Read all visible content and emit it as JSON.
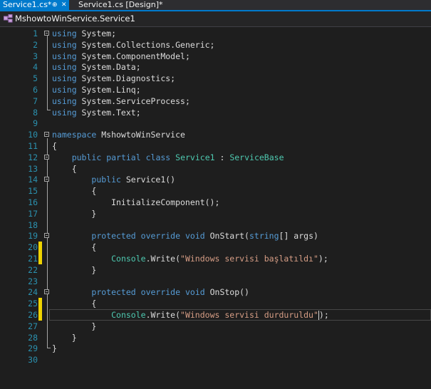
{
  "tabs": [
    {
      "label": "Service1.cs*",
      "pin_icon": "pin-icon",
      "close_icon": "close-icon",
      "active": true
    },
    {
      "label": "Service1.cs [Design]*",
      "active": false
    }
  ],
  "navbar": {
    "icon": "class-icon",
    "label": "MshowtoWinService.Service1"
  },
  "colors": {
    "keyword": "#569cd6",
    "type": "#4ec9b0",
    "string": "#d69d85",
    "line_number": "#2b91af",
    "active_tab": "#007acc",
    "change_marker": "#efd300"
  },
  "editor": {
    "lines": [
      {
        "num": "1",
        "tokens": [
          [
            "kw",
            "using"
          ],
          [
            "p",
            " System;"
          ]
        ],
        "fold": true
      },
      {
        "num": "2",
        "tokens": [
          [
            "kw",
            "using"
          ],
          [
            "p",
            " System.Collections.Generic;"
          ]
        ]
      },
      {
        "num": "3",
        "tokens": [
          [
            "kw",
            "using"
          ],
          [
            "p",
            " System.ComponentModel;"
          ]
        ]
      },
      {
        "num": "4",
        "tokens": [
          [
            "kw",
            "using"
          ],
          [
            "p",
            " System.Data;"
          ]
        ]
      },
      {
        "num": "5",
        "tokens": [
          [
            "kw",
            "using"
          ],
          [
            "p",
            " System.Diagnostics;"
          ]
        ]
      },
      {
        "num": "6",
        "tokens": [
          [
            "kw",
            "using"
          ],
          [
            "p",
            " System.Linq;"
          ]
        ]
      },
      {
        "num": "7",
        "tokens": [
          [
            "kw",
            "using"
          ],
          [
            "p",
            " System.ServiceProcess;"
          ]
        ]
      },
      {
        "num": "8",
        "tokens": [
          [
            "kw",
            "using"
          ],
          [
            "p",
            " System.Text;"
          ]
        ]
      },
      {
        "num": "9",
        "tokens": []
      },
      {
        "num": "10",
        "tokens": [
          [
            "kw",
            "namespace"
          ],
          [
            "p",
            " MshowtoWinService"
          ]
        ],
        "fold": true
      },
      {
        "num": "11",
        "tokens": [
          [
            "p",
            "{"
          ]
        ]
      },
      {
        "num": "12",
        "tokens": [
          [
            "p",
            "    "
          ],
          [
            "kw",
            "public"
          ],
          [
            "p",
            " "
          ],
          [
            "kw",
            "partial"
          ],
          [
            "p",
            " "
          ],
          [
            "kw",
            "class"
          ],
          [
            "p",
            " "
          ],
          [
            "ty",
            "Service1"
          ],
          [
            "p",
            " : "
          ],
          [
            "ty",
            "ServiceBase"
          ]
        ],
        "fold": true
      },
      {
        "num": "13",
        "tokens": [
          [
            "p",
            "    {"
          ]
        ]
      },
      {
        "num": "14",
        "tokens": [
          [
            "p",
            "        "
          ],
          [
            "kw",
            "public"
          ],
          [
            "p",
            " Service1()"
          ]
        ],
        "fold": true
      },
      {
        "num": "15",
        "tokens": [
          [
            "p",
            "        {"
          ]
        ]
      },
      {
        "num": "16",
        "tokens": [
          [
            "p",
            "            InitializeComponent();"
          ]
        ]
      },
      {
        "num": "17",
        "tokens": [
          [
            "p",
            "        }"
          ]
        ]
      },
      {
        "num": "18",
        "tokens": []
      },
      {
        "num": "19",
        "tokens": [
          [
            "p",
            "        "
          ],
          [
            "kw",
            "protected"
          ],
          [
            "p",
            " "
          ],
          [
            "kw",
            "override"
          ],
          [
            "p",
            " "
          ],
          [
            "kw",
            "void"
          ],
          [
            "p",
            " OnStart("
          ],
          [
            "kw",
            "string"
          ],
          [
            "p",
            "[] args)"
          ]
        ],
        "fold": true
      },
      {
        "num": "20",
        "tokens": [
          [
            "p",
            "        {"
          ]
        ],
        "changed": true
      },
      {
        "num": "21",
        "tokens": [
          [
            "p",
            "            "
          ],
          [
            "ty",
            "Console"
          ],
          [
            "p",
            ".Write("
          ],
          [
            "str",
            "\"Windows servisi başlatıldı\""
          ],
          [
            "p",
            ");"
          ]
        ],
        "changed": true
      },
      {
        "num": "22",
        "tokens": [
          [
            "p",
            "        }"
          ]
        ]
      },
      {
        "num": "23",
        "tokens": []
      },
      {
        "num": "24",
        "tokens": [
          [
            "p",
            "        "
          ],
          [
            "kw",
            "protected"
          ],
          [
            "p",
            " "
          ],
          [
            "kw",
            "override"
          ],
          [
            "p",
            " "
          ],
          [
            "kw",
            "void"
          ],
          [
            "p",
            " OnStop()"
          ]
        ],
        "fold": true
      },
      {
        "num": "25",
        "tokens": [
          [
            "p",
            "        {"
          ]
        ],
        "changed": true
      },
      {
        "num": "26",
        "tokens": [
          [
            "p",
            "            "
          ],
          [
            "ty",
            "Console"
          ],
          [
            "p",
            ".Write("
          ],
          [
            "str",
            "\"Windows servisi durduruldu"
          ],
          [
            "str",
            "\""
          ],
          [
            "p",
            ");"
          ]
        ],
        "changed": true,
        "caret": true
      },
      {
        "num": "27",
        "tokens": [
          [
            "p",
            "        }"
          ]
        ]
      },
      {
        "num": "28",
        "tokens": [
          [
            "p",
            "    }"
          ]
        ]
      },
      {
        "num": "29",
        "tokens": [
          [
            "p",
            "}"
          ]
        ]
      },
      {
        "num": "30",
        "tokens": []
      }
    ]
  }
}
